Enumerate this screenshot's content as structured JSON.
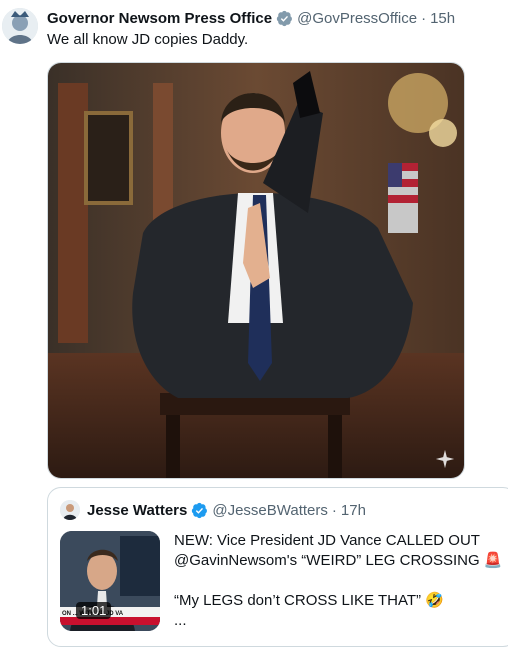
{
  "tweet": {
    "author_name": "Governor Newsom Press Office",
    "handle": "@GovPressOffice",
    "separator": "·",
    "time": "15h",
    "text": "We all know JD copies Daddy.",
    "media": {
      "icon": "sparkle-icon"
    }
  },
  "quoted_tweet": {
    "author_name": "Jesse Watters",
    "handle": "@JesseBWatters",
    "separator": "·",
    "time": "17h",
    "line1": "NEW: Vice President JD Vance CALLED OUT @GavinNewsom's “WEIRD” LEG CROSSING 🚨",
    "line2": "“My LEGS don’t CROSS LIKE THAT” 🤣",
    "more": "...",
    "video": {
      "duration": "1:01",
      "banner_text": "ON ... WITH VP JD VA"
    }
  },
  "colors": {
    "verified": "#1d9bf0",
    "muted": "#536471",
    "border": "#cfd9de"
  }
}
